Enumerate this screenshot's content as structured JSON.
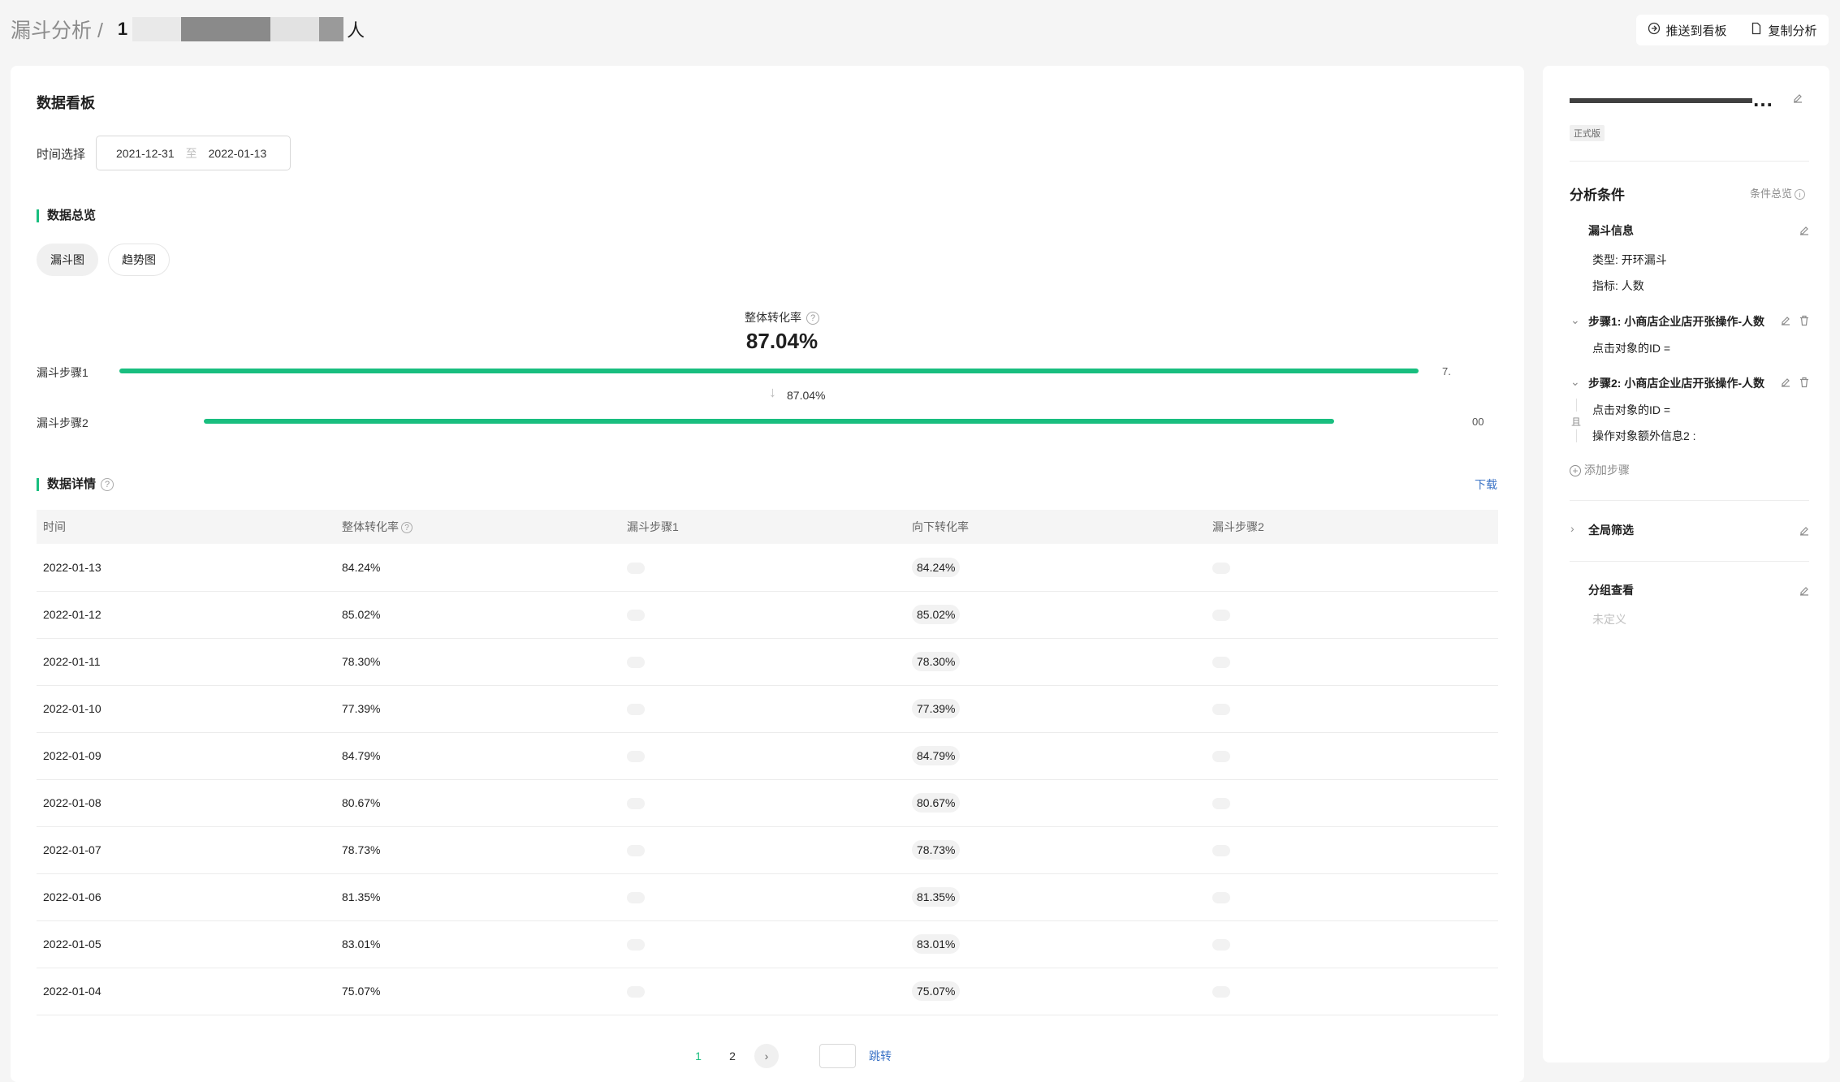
{
  "breadcrumb": {
    "root": "漏斗分析 /",
    "prefix": "1",
    "suffix": "人"
  },
  "header_actions": {
    "push_board": "推送到看板",
    "copy": "复制分析"
  },
  "main": {
    "title": "数据看板",
    "date_label": "时间选择",
    "date_start": "2021-12-31",
    "date_sep": "至",
    "date_end": "2022-01-13",
    "overview_title": "数据总览",
    "tabs": [
      "漏斗图",
      "趋势图"
    ],
    "funnel": {
      "overall_label": "整体转化率",
      "overall_value": "87.04%",
      "step1_label": "漏斗步骤1",
      "step2_label": "漏斗步骤2",
      "step_conversion": "87.04%",
      "step1_value": "7.",
      "step2_value": "00",
      "step1_fill": 1.0,
      "step2_fill": 0.87
    },
    "detail_title": "数据详情",
    "download": "下载",
    "table": {
      "headers": [
        "时间",
        "整体转化率",
        "漏斗步骤1",
        "向下转化率",
        "漏斗步骤2"
      ],
      "rows": [
        {
          "date": "2022-01-13",
          "overall": "84.24%",
          "down": "84.24%"
        },
        {
          "date": "2022-01-12",
          "overall": "85.02%",
          "down": "85.02%"
        },
        {
          "date": "2022-01-11",
          "overall": "78.30%",
          "down": "78.30%"
        },
        {
          "date": "2022-01-10",
          "overall": "77.39%",
          "down": "77.39%"
        },
        {
          "date": "2022-01-09",
          "overall": "84.79%",
          "down": "84.79%"
        },
        {
          "date": "2022-01-08",
          "overall": "80.67%",
          "down": "80.67%"
        },
        {
          "date": "2022-01-07",
          "overall": "78.73%",
          "down": "78.73%"
        },
        {
          "date": "2022-01-06",
          "overall": "81.35%",
          "down": "81.35%"
        },
        {
          "date": "2022-01-05",
          "overall": "83.01%",
          "down": "83.01%"
        },
        {
          "date": "2022-01-04",
          "overall": "75.07%",
          "down": "75.07%"
        }
      ]
    },
    "pager": {
      "pages": [
        "1",
        "2"
      ],
      "current": "1",
      "next": "›",
      "jump": "跳转"
    }
  },
  "side": {
    "title": "…",
    "version": "正式版",
    "conditions_title": "分析条件",
    "conditions_overview": "条件总览",
    "funnel_info": "漏斗信息",
    "type": "类型: 开环漏斗",
    "metric": "指标: 人数",
    "step1": "步骤1:  小商店企业店开张操作-人数",
    "step1_cond": "点击对象的ID =",
    "step2": "步骤2:  小商店企业店开张操作-人数",
    "step2_cond1": "点击对象的ID =",
    "step2_cond2": "操作对象额外信息2 :",
    "and_label": "且",
    "add_step": "添加步骤",
    "global_filter": "全局筛选",
    "group_view": "分组查看",
    "undefined": "未定义"
  },
  "colors": {
    "accent": "#19be7f",
    "link": "#3b73c6"
  }
}
